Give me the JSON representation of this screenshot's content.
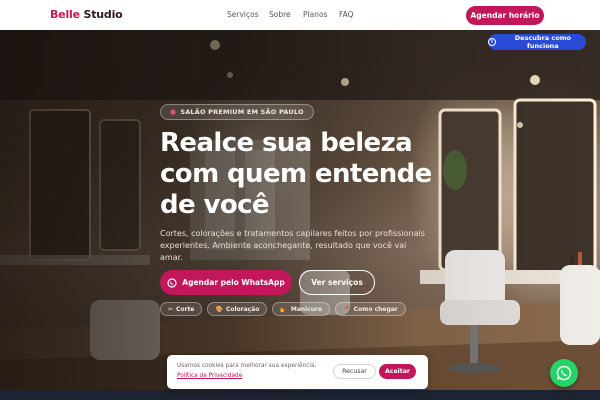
{
  "header": {
    "brand_part1": "Belle",
    "brand_part2": " Studio",
    "nav": [
      "Serviços",
      "Sobre",
      "Planos",
      "FAQ"
    ],
    "cta_label": "Agendar horário"
  },
  "hero": {
    "discover_label": "Descubra como funciona",
    "badge_label": "SALÃO PREMIUM EM SÃO PAULO",
    "title_line1": "Realce sua beleza",
    "title_line2": "com quem entende",
    "title_line3": "de você",
    "subtitle": "Cortes, colorações e tratamentos capilares feitos por profissionais experientes. Ambiente aconchegante, resultado que você vai amar.",
    "primary_cta": "Agendar pelo WhatsApp",
    "secondary_cta": "Ver serviços",
    "chips": [
      {
        "icon": "scissors-icon",
        "glyph": "✂",
        "label": "Corte"
      },
      {
        "icon": "palette-icon",
        "glyph": "🎨",
        "label": "Coloração"
      },
      {
        "icon": "nail-polish-icon",
        "glyph": "💅",
        "label": "Manicure"
      },
      {
        "icon": "map-pin-icon",
        "glyph": "📍",
        "label": "Como chegar"
      }
    ]
  },
  "cookie": {
    "text": "Usamos cookies para melhorar sua experiência.",
    "link": "Política de Privacidade",
    "reject_label": "Recusar",
    "accept_label": "Aceitar"
  },
  "colors": {
    "brand": "#c2185b",
    "discover": "#2a4bd8",
    "whatsapp": "#25d366"
  }
}
